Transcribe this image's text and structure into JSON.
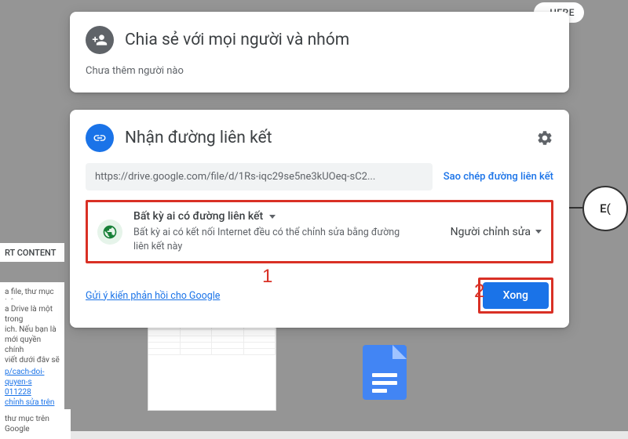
{
  "background": {
    "here_fragment": "HERE",
    "chart_label": "E(",
    "sidebar_label": "RT CONTENT",
    "sidebar_snippets": [
      "a file, thư mục trên",
      "a Drive là một trong\nich. Nếu bạn là\nmới quyền chính\nviết dưới đây sẽ\no bạn. Cùng tìm",
      "p/cach-doi-quyen-s\n011228\nchỉnh sửa trên",
      "thư mục trên Google"
    ]
  },
  "share_card": {
    "title": "Chia sẻ với mọi người và nhóm",
    "subtitle": "Chưa thêm người nào"
  },
  "link_card": {
    "title": "Nhận đường liên kết",
    "url": "https://drive.google.com/file/d/1Rs-iqc29se5ne3kUOeq-sC2...",
    "copy_label": "Sao chép đường liên kết",
    "access": {
      "main": "Bất kỳ ai có đường liên kết",
      "desc": "Bất kỳ ai có kết nối Internet đều có thể chỉnh sửa bằng đường liên kết này",
      "role": "Người chỉnh sửa"
    },
    "feedback": "Gửi ý kiến phản hồi cho Google",
    "done": "Xong"
  },
  "annotations": {
    "one": "1",
    "two": "2"
  }
}
